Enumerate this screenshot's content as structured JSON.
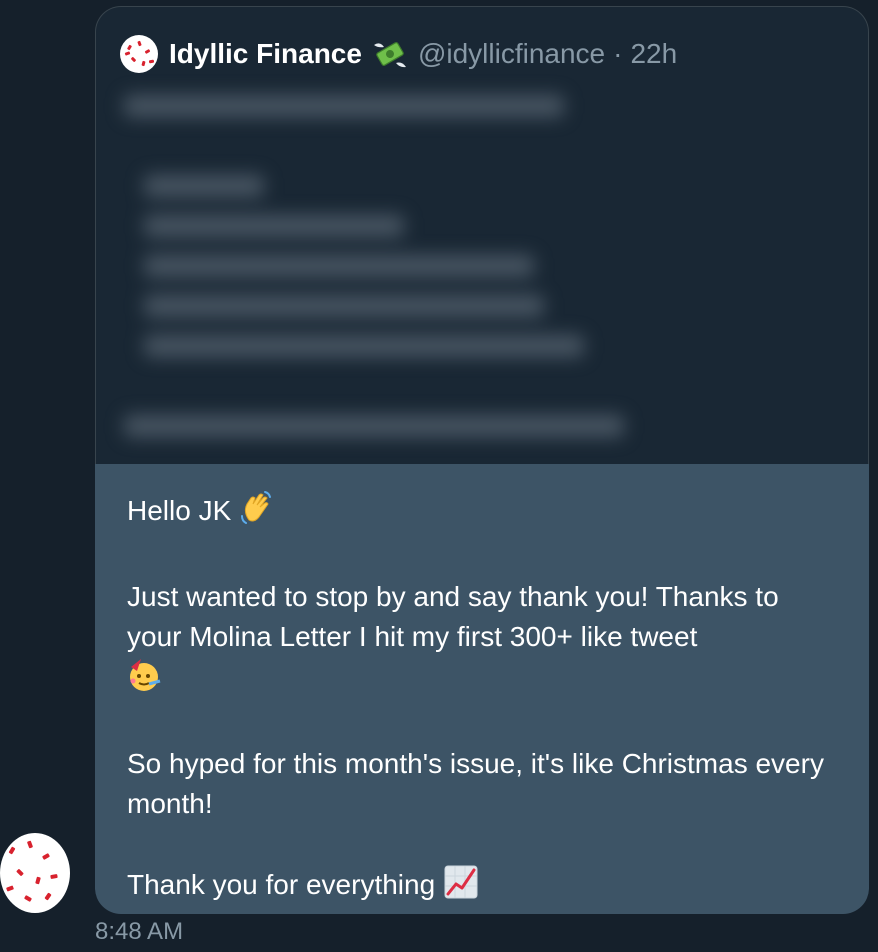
{
  "quoted_tweet": {
    "display_name": "Idyllic Finance",
    "name_icon": "money-with-wings-icon",
    "handle": "@idyllicfinance",
    "separator": "·",
    "time_ago": "22h",
    "body_blurred": true
  },
  "message": {
    "lines": [
      "Hello JK",
      "Just wanted to stop by and say thank you! Thanks to your Molina Letter I hit my first 300+ like tweet",
      "So hyped for this month's issue, it's like Christmas every month!",
      "Thank you for everything"
    ],
    "emojis": [
      "waving-hand-icon",
      "partying-face-icon",
      "chart-increasing-icon"
    ],
    "bubble_color": "#3d5466"
  },
  "timestamp": "8:48 AM",
  "colors": {
    "background": "#15202b",
    "card": "#192734",
    "muted_text": "#8899a6"
  }
}
